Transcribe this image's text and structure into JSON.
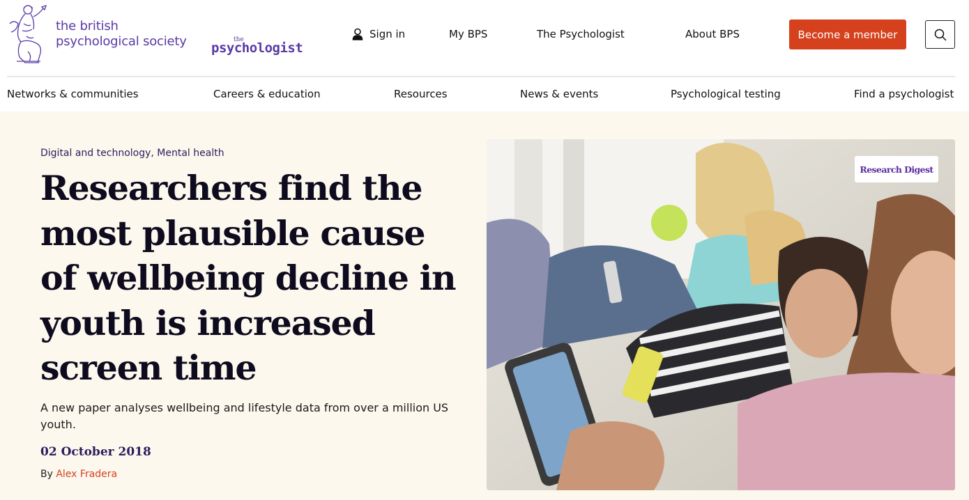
{
  "brand": {
    "society_line1": "the british",
    "society_line2": "psychological society",
    "psychologist_the": "the",
    "psychologist_word": "psychologist",
    "accent_color": "#5a3aa6",
    "cta_color": "#d6411d"
  },
  "top_nav": {
    "sign_in": "Sign in",
    "my_bps": "My BPS",
    "the_psychologist": "The Psychologist",
    "about_bps": "About BPS",
    "become_member": "Become a member",
    "search_icon": "search-icon",
    "user_icon": "user-icon"
  },
  "main_nav": [
    "Networks & communities",
    "Careers & education",
    "Resources",
    "News & events",
    "Psychological testing",
    "Find a psychologist"
  ],
  "article": {
    "tags": "Digital and technology, Mental health",
    "headline": "Researchers find the most plausible cause of wellbeing decline in youth is increased screen time",
    "standfirst": "A new paper analyses wellbeing and lifestyle data from over a million US youth.",
    "date": "02 October 2018",
    "by_prefix": "By ",
    "author": "Alex Fradera",
    "image_badge": "Research Digest"
  }
}
